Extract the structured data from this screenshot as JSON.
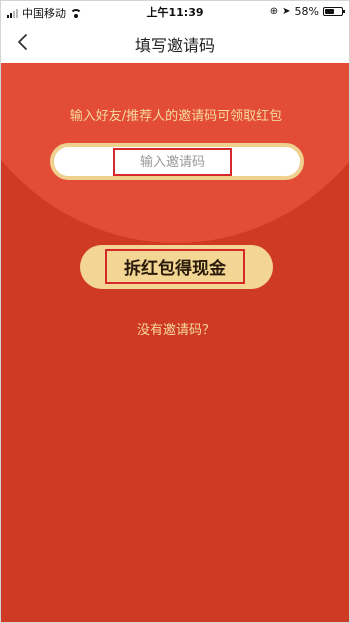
{
  "status_bar": {
    "carrier": "中国移动",
    "time": "上午11:39",
    "battery_percent": "58%",
    "battery_level": 0.58
  },
  "nav": {
    "title": "填写邀请码",
    "back_icon": "chevron-left-icon"
  },
  "envelope": {
    "hint": "输入好友/推荐人的邀请码可领取红包",
    "code_input_placeholder": "输入邀请码",
    "redeem_button": "拆红包得现金",
    "no_code_link": "没有邀请码？"
  },
  "colors": {
    "envelope_red": "#cf3a25",
    "envelope_top": "#e34c36",
    "gold": "#f3d693",
    "hint_text": "#f6d9a0",
    "highlight_box": "#d62a2a"
  }
}
